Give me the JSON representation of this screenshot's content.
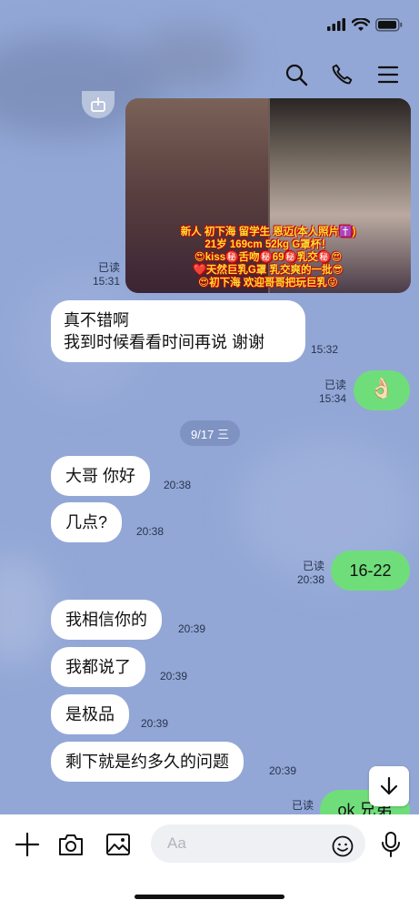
{
  "colors": {
    "background": "#92a7d6",
    "incoming": "#ffffff",
    "outgoing": "#6fde7a"
  },
  "status_bar": {
    "icons": [
      "signal-icon",
      "wifi-icon",
      "battery-icon"
    ]
  },
  "header": {
    "icons": [
      "search-icon",
      "phone-icon",
      "menu-icon"
    ]
  },
  "photo_message": {
    "caption_lines": [
      "新人 初下海 留学生 恩迈(本人照片✝️)",
      "21岁 169cm 52kg G罩杯！",
      "😍kiss㊙️舌吻㊙️69㊙️乳交㊙️😍",
      "❤️天然巨乳G罩 乳交爽的一批😎",
      "😍初下海 欢迎哥哥把玩巨乳😜"
    ],
    "read": "已读",
    "time": "15:31"
  },
  "messages": [
    {
      "id": "m1",
      "text_lines": [
        "真不错啊",
        "我到时候看看时间再说 谢谢"
      ],
      "time": "15:32"
    },
    {
      "id": "m2",
      "text": "👌🏻",
      "read": "已读",
      "time": "15:34"
    },
    {
      "id": "m3",
      "text": "大哥 你好",
      "time": "20:38"
    },
    {
      "id": "m4",
      "text": "几点?",
      "time": "20:38"
    },
    {
      "id": "m5",
      "text": "16-22",
      "read": "已读",
      "time": "20:38"
    },
    {
      "id": "m6",
      "text": "我相信你的",
      "time": "20:39"
    },
    {
      "id": "m7",
      "text": "我都说了",
      "time": "20:39"
    },
    {
      "id": "m8",
      "text": "是极品",
      "time": "20:39"
    },
    {
      "id": "m9",
      "text": "剩下就是约多久的问题",
      "time": "20:39"
    },
    {
      "id": "m10",
      "text": "ok 兄弟",
      "read": "已读"
    }
  ],
  "date_divider": "9/17 三",
  "input": {
    "placeholder": "Aa"
  }
}
